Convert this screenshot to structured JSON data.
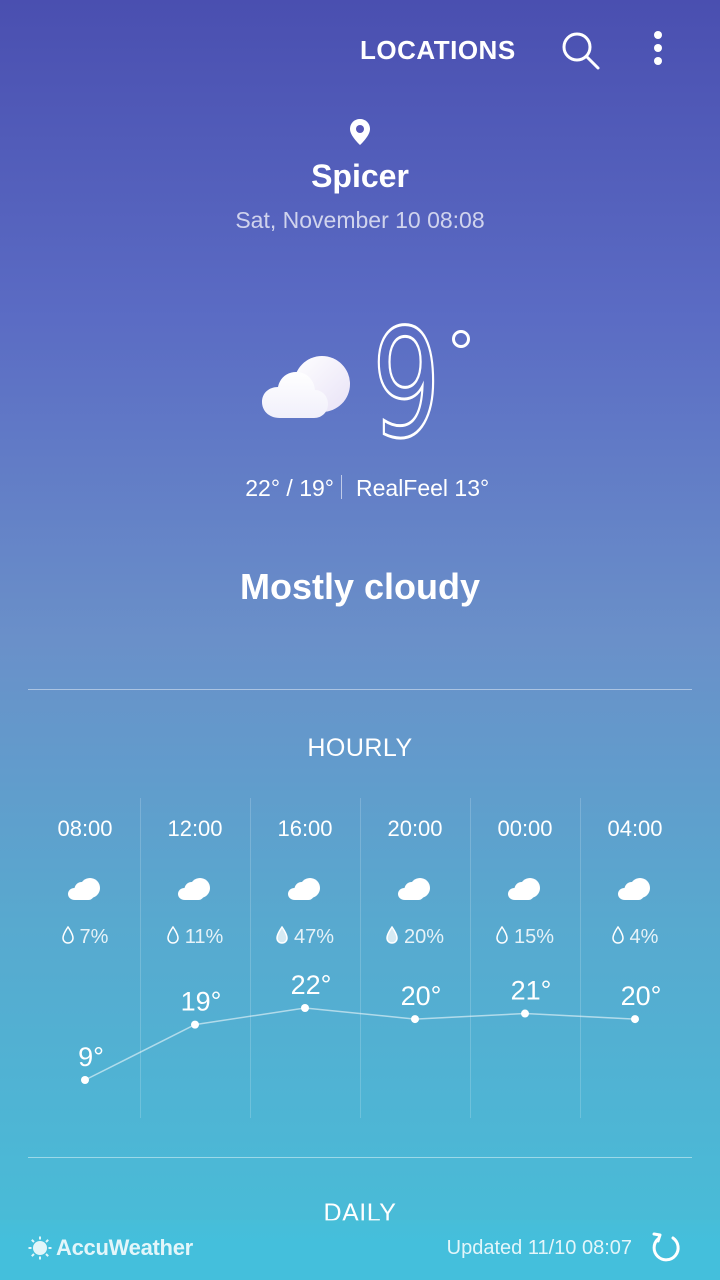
{
  "header": {
    "locations_label": "LOCATIONS",
    "search_icon": "search-icon",
    "more_icon": "more-vert-icon"
  },
  "location": {
    "city": "Spicer",
    "datetime": "Sat, November 10 08:08"
  },
  "current": {
    "temperature": "9",
    "hi_lo": "22° / 19°",
    "realfeel": "RealFeel 13°",
    "condition": "Mostly cloudy",
    "icon": "mostly-cloudy-icon"
  },
  "hourly": {
    "title": "HOURLY",
    "items": [
      {
        "time": "08:00",
        "rain": "7%",
        "temp_label": "9°",
        "temp": 9
      },
      {
        "time": "12:00",
        "rain": "11%",
        "temp_label": "19°",
        "temp": 19
      },
      {
        "time": "16:00",
        "rain": "47%",
        "temp_label": "22°",
        "temp": 22
      },
      {
        "time": "20:00",
        "rain": "20%",
        "temp_label": "20°",
        "temp": 20
      },
      {
        "time": "00:00",
        "rain": "15%",
        "temp_label": "21°",
        "temp": 21
      },
      {
        "time": "04:00",
        "rain": "4%",
        "temp_label": "20°",
        "temp": 20
      }
    ]
  },
  "daily": {
    "title": "DAILY"
  },
  "footer": {
    "brand": "AccuWeather",
    "updated": "Updated  11/10  08:07",
    "refresh_icon": "refresh-icon"
  },
  "colors": {
    "gradient_top": "#4a4fb0",
    "gradient_bottom": "#46bfd9",
    "text": "#ffffff"
  }
}
